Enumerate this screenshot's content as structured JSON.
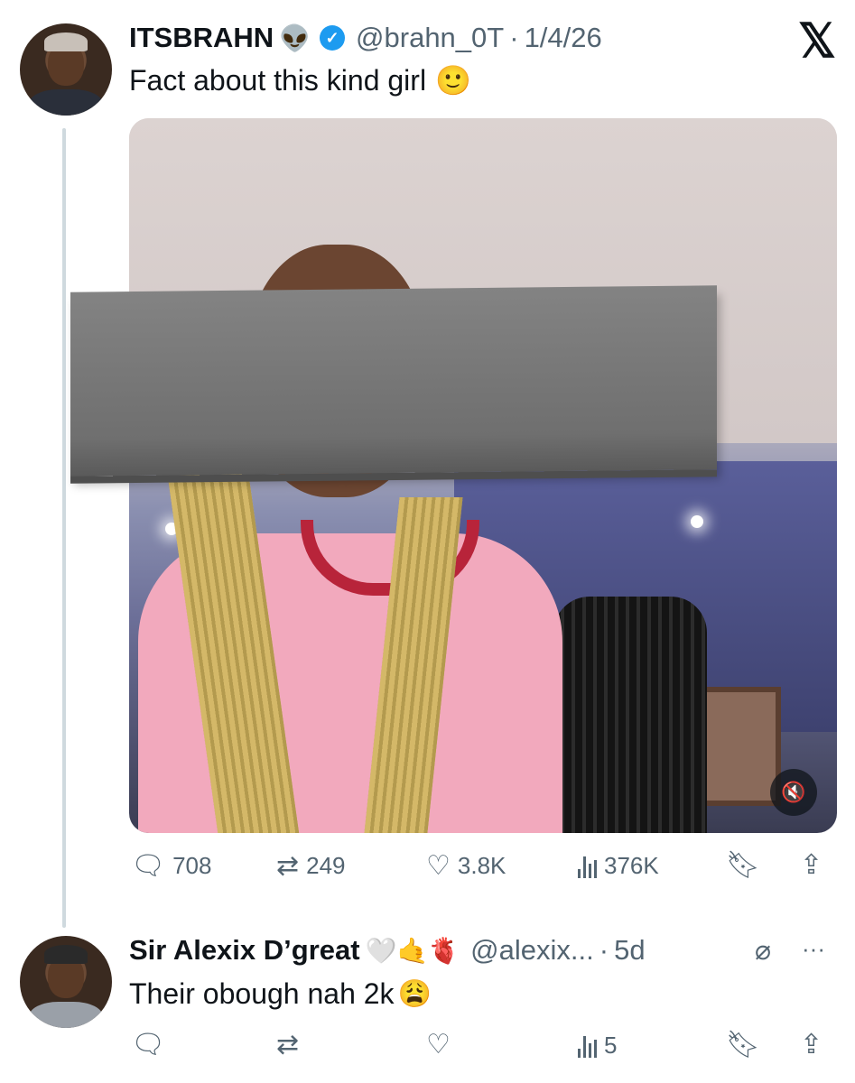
{
  "tweet": {
    "display_name": "ITSBRAHN",
    "name_emoji": "👽",
    "handle": "@brahn_0T",
    "separator": "·",
    "date": "1/4/26",
    "text": "Fact about this kind girl",
    "text_emoji": "🙂",
    "actions": {
      "replies": "708",
      "reposts": "249",
      "likes": "3.8K",
      "views": "376K"
    }
  },
  "reply": {
    "display_name": "Sir Alexix D’great",
    "name_emojis": "🤍🤙🫀",
    "handle": "@alexix...",
    "separator": "·",
    "time": "5d",
    "text": "Their obough nah 2k",
    "text_emoji": "😩",
    "actions": {
      "views": "5"
    }
  },
  "icons": {
    "brand": "x-logo",
    "verified": "verified-badge",
    "more": "more-icon"
  },
  "colors": {
    "verified_blue": "#1d9bf0",
    "muted_text": "#536471",
    "thread_line": "#cfd9de"
  }
}
